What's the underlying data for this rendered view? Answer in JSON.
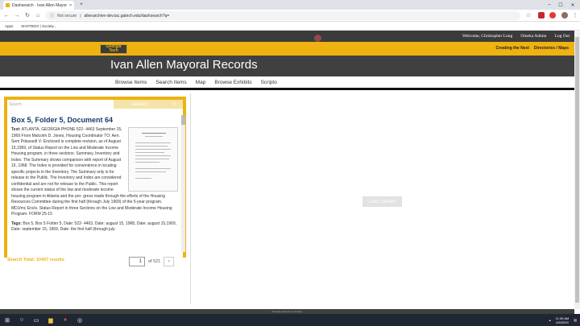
{
  "browser": {
    "tab_title": "Dashsearch · Ivan Allen Mayor...",
    "tab_close": "×",
    "new_tab": "+",
    "not_secure": "Not secure",
    "url": "allenarchive-dev.iac.gatech.edu/dashsearch?q=",
    "bookmarks": [
      "Apps",
      "SHOTBOX | Society..."
    ]
  },
  "admin_bar": {
    "items": [
      "Welcome, Christopher Long",
      "Omeka Admin",
      "Log Out"
    ]
  },
  "logo": {
    "line1": "Georgia",
    "line2": "Tech"
  },
  "gold_links": [
    "Creating the Next",
    "Directories / Maps"
  ],
  "site_title": "Ivan Allen Mayoral Records",
  "nav": [
    "Browse Items",
    "Search Items",
    "Map",
    "Browse Exhibits",
    "Scripto"
  ],
  "search": {
    "placeholder": "Search",
    "button": "SEARCH"
  },
  "result": {
    "title": "Box 5, Folder 5, Document 64",
    "text_label": "Text:",
    "text": "ATLANTA, GEORGIA PHONE 522- 4463 September 15, 1969 From Malcolm D. Jones, Housing Coordinator TO: Aen. Sem Pdassedl V- Enclosed is complete revision, as of August 15,1969, of Status Report on the Low and Moderate Income Housing program, in three sections: Summary, Inventory and Index. The Summary shows comparison with report of August 15, 1968. The Index is provided for convenience in locating specific projects in the Inventory. The Summary only is for release to the Public. The Inventory and Index are considered confidential and are not for release to the Public. This report shows the current status of the low and moderate income housing program in Atlanta and the pro- gress made through the efforts of the Housing Resources Committee during the first half (through July 1969) of the 5-year program. MDJ/mc Encls. Status Report in three Sections on the Low and Moderate Income Housing Program: FORM 25-15",
    "tags_label": "Tags:",
    "tags": "Box 5, Box 5 Folder 5, Date: 522- 4463, Date: august 15, 1968, Date: august 15,1969, Date: september 15, 1969, Date: the first half (through july"
  },
  "search_total": "Search Total: 10407 results",
  "pager": {
    "page": "1",
    "of": "of 521",
    "next": "›"
  },
  "load_button": "LOAD LIBRARY",
  "footer": "Proudly powered by Omeka.",
  "taskbar": {
    "time": "11:30 AM",
    "date": "4/5/2019"
  },
  "colors": {
    "gold": "#eeb211",
    "dark": "#404040",
    "title_blue": "#1a3a6e"
  }
}
